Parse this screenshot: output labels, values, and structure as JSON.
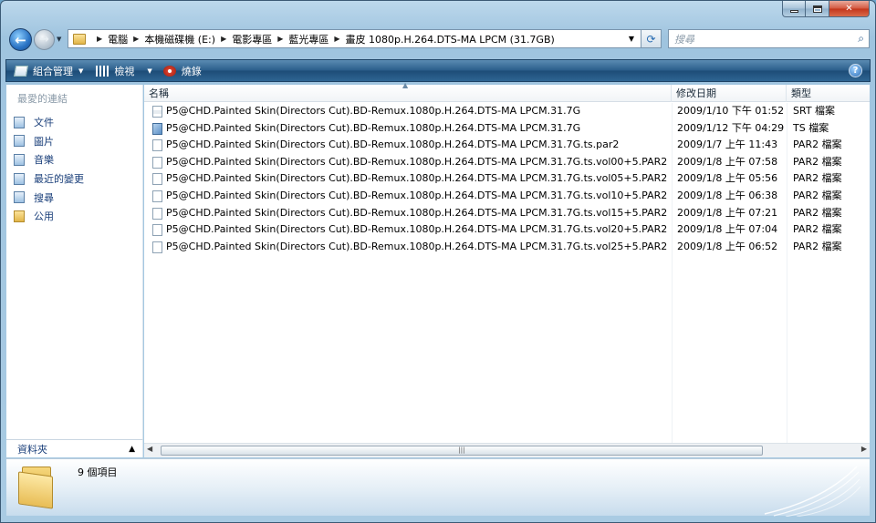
{
  "address": {
    "crumbs": [
      "電腦",
      "本機磁碟機 (E:)",
      "電影專區",
      "藍光專區",
      "畫皮 1080p.H.264.DTS-MA LPCM (31.7GB)"
    ]
  },
  "search": {
    "placeholder": "搜尋"
  },
  "toolbar": {
    "organize": "組合管理",
    "views": "檢視",
    "burn": "燒錄"
  },
  "nav": {
    "title": "最愛的連結",
    "items": [
      {
        "label": "文件",
        "icon": "documents-icon"
      },
      {
        "label": "圖片",
        "icon": "pictures-icon"
      },
      {
        "label": "音樂",
        "icon": "music-icon"
      },
      {
        "label": "最近的變更",
        "icon": "recent-changes-icon"
      },
      {
        "label": "搜尋",
        "icon": "searches-icon"
      },
      {
        "label": "公用",
        "icon": "public-folder-icon"
      }
    ],
    "folders_label": "資料夾"
  },
  "columns": {
    "name": "名稱",
    "date": "修改日期",
    "type": "類型"
  },
  "files": [
    {
      "name": "P5@CHD.Painted Skin(Directors Cut).BD-Remux.1080p.H.264.DTS-MA LPCM.31.7G",
      "date": "2009/1/10 下午 01:52",
      "type": "SRT 檔案",
      "icon": "srt"
    },
    {
      "name": "P5@CHD.Painted Skin(Directors Cut).BD-Remux.1080p.H.264.DTS-MA LPCM.31.7G",
      "date": "2009/1/12 下午 04:29",
      "type": "TS 檔案",
      "icon": "ts"
    },
    {
      "name": "P5@CHD.Painted Skin(Directors Cut).BD-Remux.1080p.H.264.DTS-MA LPCM.31.7G.ts.par2",
      "date": "2009/1/7 上午 11:43",
      "type": "PAR2 檔案",
      "icon": "par2"
    },
    {
      "name": "P5@CHD.Painted Skin(Directors Cut).BD-Remux.1080p.H.264.DTS-MA LPCM.31.7G.ts.vol00+5.PAR2",
      "date": "2009/1/8 上午 07:58",
      "type": "PAR2 檔案",
      "icon": "par2"
    },
    {
      "name": "P5@CHD.Painted Skin(Directors Cut).BD-Remux.1080p.H.264.DTS-MA LPCM.31.7G.ts.vol05+5.PAR2",
      "date": "2009/1/8 上午 05:56",
      "type": "PAR2 檔案",
      "icon": "par2"
    },
    {
      "name": "P5@CHD.Painted Skin(Directors Cut).BD-Remux.1080p.H.264.DTS-MA LPCM.31.7G.ts.vol10+5.PAR2",
      "date": "2009/1/8 上午 06:38",
      "type": "PAR2 檔案",
      "icon": "par2"
    },
    {
      "name": "P5@CHD.Painted Skin(Directors Cut).BD-Remux.1080p.H.264.DTS-MA LPCM.31.7G.ts.vol15+5.PAR2",
      "date": "2009/1/8 上午 07:21",
      "type": "PAR2 檔案",
      "icon": "par2"
    },
    {
      "name": "P5@CHD.Painted Skin(Directors Cut).BD-Remux.1080p.H.264.DTS-MA LPCM.31.7G.ts.vol20+5.PAR2",
      "date": "2009/1/8 上午 07:04",
      "type": "PAR2 檔案",
      "icon": "par2"
    },
    {
      "name": "P5@CHD.Painted Skin(Directors Cut).BD-Remux.1080p.H.264.DTS-MA LPCM.31.7G.ts.vol25+5.PAR2",
      "date": "2009/1/8 上午 06:52",
      "type": "PAR2 檔案",
      "icon": "par2"
    }
  ],
  "status": {
    "item_count": "9 個項目"
  },
  "colors": {
    "toolbar": "#2a5d8a",
    "link": "#1a3f7a",
    "close": "#c3351b"
  }
}
